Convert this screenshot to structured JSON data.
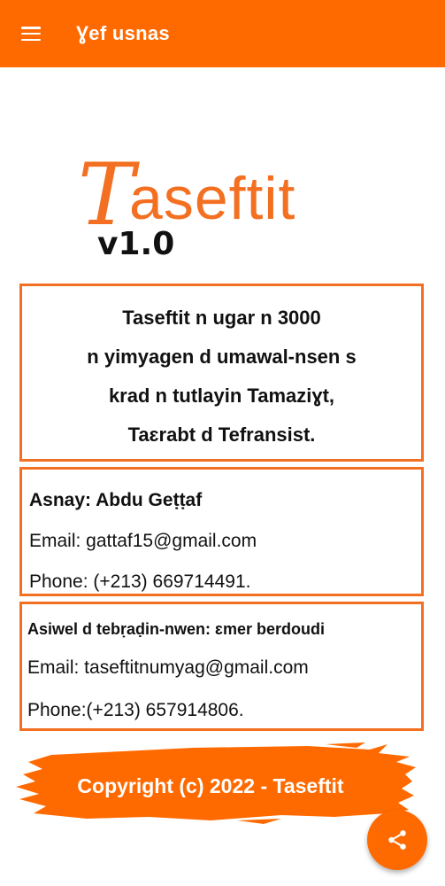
{
  "app_bar": {
    "title": "Ɣef usnas",
    "menu_icon": "hamburger-menu-icon"
  },
  "logo": {
    "first_letter": "T",
    "rest_of_word": "aseftit",
    "version": "v1.0",
    "color": "#f36f21"
  },
  "description": {
    "lines": [
      "Taseftit n ugar n 3000",
      "n yimyagen d umawal-nsen s",
      "krad  n tutlayin Tamaziɣt,",
      "Taɛrabt  d Tefransist."
    ]
  },
  "author": {
    "name": "Asnay: Abdu Geṭṭaf",
    "email": "Email: gattaf15@gmail.com",
    "phone": "Phone: (+213) 669714491."
  },
  "helper": {
    "name": "Asiwel d tebṛaḍin-nwen: ɛmer berdoudi",
    "email": "Email: taseftitnumyag@gmail.com",
    "phone": "Phone:(+213) 657914806."
  },
  "footer": {
    "copyright": "Copyright (c)  2022 - Taseftit"
  },
  "fab": {
    "icon": "share-icon"
  },
  "colors": {
    "accent": "#ff6a00",
    "border": "#f36f21"
  }
}
